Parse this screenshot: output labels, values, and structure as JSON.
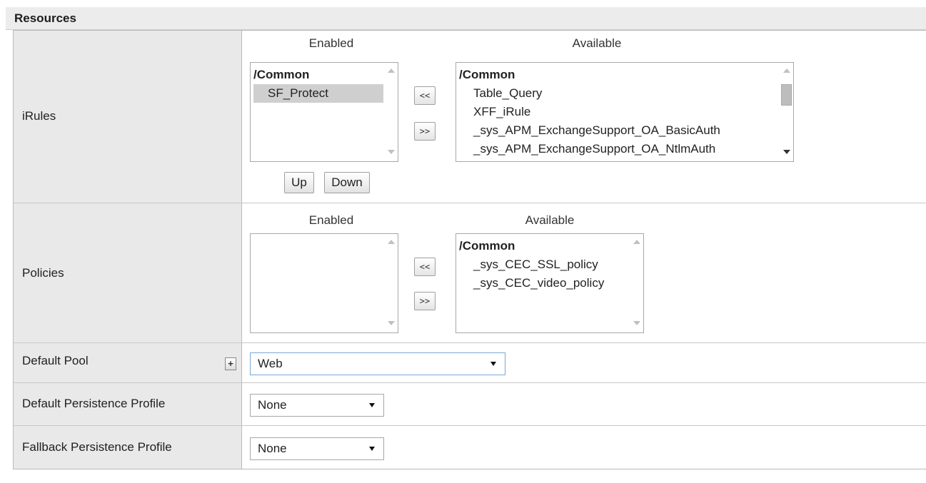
{
  "section": {
    "title": "Resources"
  },
  "irules": {
    "label": "iRules",
    "enabled_header": "Enabled",
    "available_header": "Available",
    "enabled_list": [
      {
        "text": "/Common",
        "type": "group"
      },
      {
        "text": "SF_Protect",
        "type": "item",
        "selected": true
      }
    ],
    "available_list": [
      {
        "text": "/Common",
        "type": "group"
      },
      {
        "text": "Table_Query",
        "type": "item"
      },
      {
        "text": "XFF_iRule",
        "type": "item"
      },
      {
        "text": "_sys_APM_ExchangeSupport_OA_BasicAuth",
        "type": "item"
      },
      {
        "text": "_sys_APM_ExchangeSupport_OA_NtlmAuth",
        "type": "item"
      }
    ],
    "move_left_label": "<<",
    "move_right_label": ">>",
    "up_label": "Up",
    "down_label": "Down"
  },
  "policies": {
    "label": "Policies",
    "enabled_header": "Enabled",
    "available_header": "Available",
    "enabled_list": [],
    "available_list": [
      {
        "text": "/Common",
        "type": "group"
      },
      {
        "text": "_sys_CEC_SSL_policy",
        "type": "item"
      },
      {
        "text": "_sys_CEC_video_policy",
        "type": "item"
      }
    ],
    "move_left_label": "<<",
    "move_right_label": ">>"
  },
  "default_pool": {
    "label": "Default Pool",
    "plus_label": "+",
    "value": "Web"
  },
  "default_persistence": {
    "label": "Default Persistence Profile",
    "value": "None"
  },
  "fallback_persistence": {
    "label": "Fallback Persistence Profile",
    "value": "None"
  }
}
